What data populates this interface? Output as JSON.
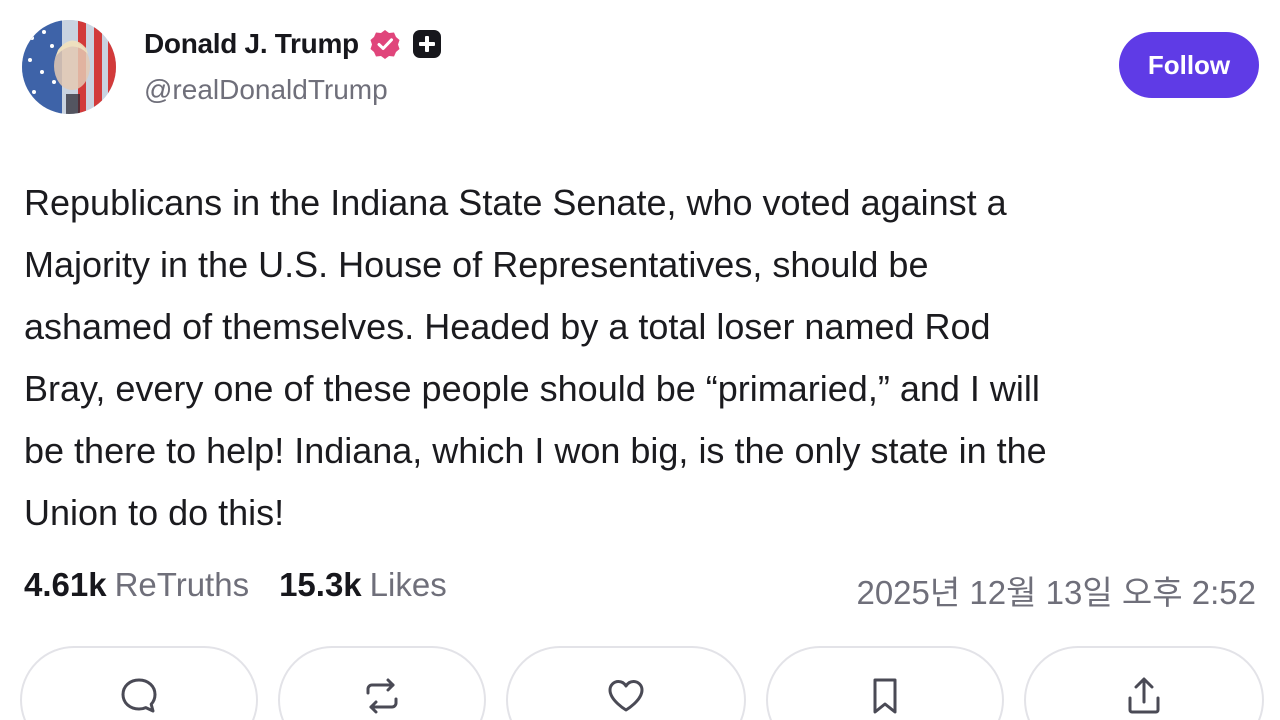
{
  "author": {
    "display_name": "Donald J. Trump",
    "handle": "@realDonaldTrump",
    "verified_badge_icon": "verified-badge-icon",
    "plus_badge_icon": "plus-badge-icon"
  },
  "follow": {
    "label": "Follow"
  },
  "post": {
    "text": "Republicans in the Indiana State Senate, who voted against a\nMajority in the U.S. House of Representatives, should be\nashamed of themselves. Headed by a total loser named Rod\nBray, every one of these people should be “primaried,” and I will\nbe there to help! Indiana, which I won big, is the only state in the\nUnion to do this!"
  },
  "stats": {
    "retruths_count": "4.61k",
    "retruths_label": "ReTruths",
    "likes_count": "15.3k",
    "likes_label": "Likes"
  },
  "timestamp": "2025년 12월 13일 오후 2:52",
  "actions": [
    {
      "icon": "reply-icon"
    },
    {
      "icon": "retruth-icon"
    },
    {
      "icon": "like-icon"
    },
    {
      "icon": "bookmark-icon"
    },
    {
      "icon": "share-icon"
    }
  ],
  "colors": {
    "accent": "#5f3be6",
    "verified_badge": "#e0457b",
    "text_primary": "#1b1b1f",
    "text_secondary": "#6f6f7a",
    "border": "#e3e3e8"
  }
}
